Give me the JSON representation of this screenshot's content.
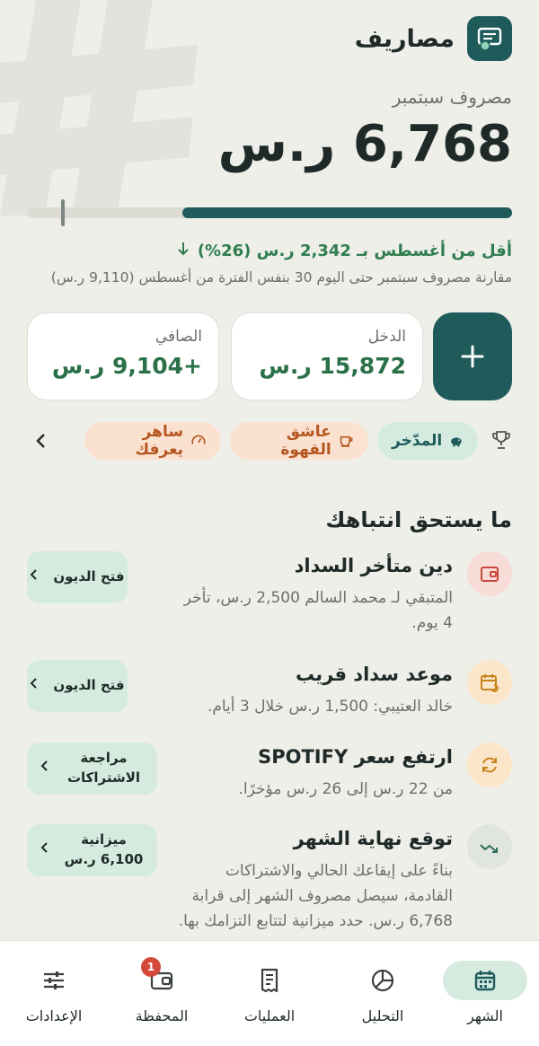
{
  "app": {
    "title": "مصاريف"
  },
  "summary": {
    "month_label": "مصروف سبتمبر",
    "amount": "6,768 ر.س",
    "progress": 0.68,
    "comparison": "أقل من أغسطس بـ 2,342 ر.س (26%)",
    "comparison_note": "مقارنة مصروف سبتمبر حتى اليوم 30 بنفس الفترة من أغسطس (9,110 ر.س)"
  },
  "cards": {
    "income": {
      "label": "الدخل",
      "value": "15,872 ر.س"
    },
    "net": {
      "label": "الصافي",
      "value": "+9,104 ر.س"
    }
  },
  "badges": [
    {
      "label": "المدّخر",
      "icon": "piggy-bank-icon"
    },
    {
      "label": "عاشق القهوة",
      "icon": "coffee-cup-icon"
    },
    {
      "label": "ساهر يعرفك",
      "icon": "gauge-icon"
    }
  ],
  "attention": {
    "title": "ما يستحق انتباهك",
    "items": [
      {
        "title": "دين متأخر السداد",
        "desc": "المتبقي لـ محمد السالم 2,500 ر.س، تأخر 4 يوم.",
        "action": "فتح الديون",
        "icon": "wallet-icon"
      },
      {
        "title": "موعد سداد قريب",
        "desc": "خالد العتيبي: 1,500 ر.س خلال 3 أيام.",
        "action": "فتح الديون",
        "icon": "calendar-repeat-icon"
      },
      {
        "title": "ارتفع سعر SPOTIFY",
        "desc": "من 22 ر.س إلى 26 ر.س مؤخرًا.",
        "action": "مراجعة الاشتراكات",
        "icon": "refresh-icon"
      },
      {
        "title": "توقع نهاية الشهر",
        "desc": "بناءً على إيقاعك الحالي والاشتراكات القادمة، سيصل مصروف الشهر إلى قرابة 6,768 ر.س. حدد ميزانية لتتابع التزامك بها.",
        "action": "ميزانية 6,100 ر.س",
        "icon": "trend-icon"
      }
    ]
  },
  "nav": {
    "month": "الشهر",
    "analysis": "التحليل",
    "transactions": "العمليات",
    "wallet": "المحفظة",
    "wallet_badge": "1",
    "settings": "الإعدادات"
  },
  "colors": {
    "primary": "#1e5b5a",
    "accent_green": "#2a7048",
    "mint": "#d5ebe0",
    "orange_bg": "#fbe1cf",
    "orange_text": "#b4561f"
  }
}
